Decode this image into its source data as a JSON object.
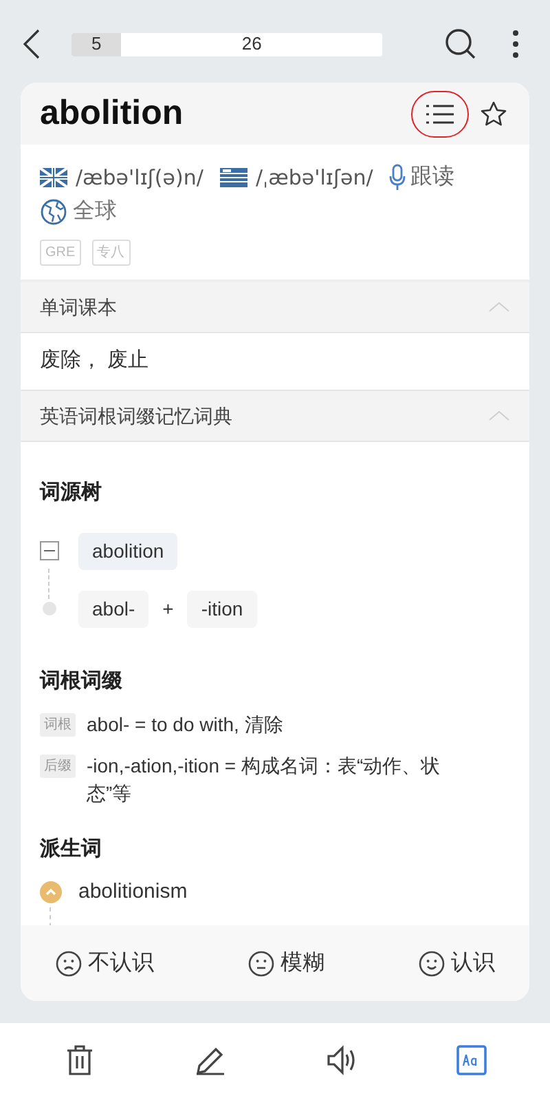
{
  "top_bar": {
    "current": "5",
    "total": "26",
    "level": 0.16
  },
  "word": {
    "text": "abolition",
    "list_highlighted": true,
    "starred": false
  },
  "pronunciations": [
    {
      "kind": "uk",
      "phonetic": "/æbə'lɪʃ(ə)n/"
    },
    {
      "kind": "us",
      "phonetic": "/ˌæbə'lɪʃən/"
    }
  ],
  "follow_read": "跟读",
  "global": "全球",
  "tags": [
    "GRE",
    "专八"
  ],
  "dictionaries": [
    {
      "kind": "meaning",
      "title": "单词课本",
      "expanded": true,
      "meaning": "废除， 废止"
    },
    {
      "kind": "roots",
      "title": "英语词根词缀记忆词典",
      "expanded": true,
      "tree": {
        "title": "词源树",
        "root": "abolition",
        "expanded": true,
        "parts": [
          "abol-",
          "-ition"
        ],
        "joiner": "+"
      },
      "affixes": {
        "title": "词根词缀",
        "items": [
          {
            "tag": "词根",
            "text": "abol- = to do with, 清除"
          },
          {
            "tag": "后缀",
            "text": "-ion,-ation,-ition = 构成名词：表“动作、状态”等"
          }
        ]
      },
      "derived": {
        "title": "派生词",
        "items": [
          {
            "word": "abolitionism",
            "expanded": true
          }
        ]
      }
    }
  ],
  "feedback": [
    {
      "kind": "sad",
      "label": "不认识"
    },
    {
      "kind": "neutral",
      "label": "模糊"
    },
    {
      "kind": "happy",
      "label": "认识"
    }
  ],
  "toolbar": [
    {
      "kind": "trash",
      "selected": false
    },
    {
      "kind": "edit",
      "selected": false
    },
    {
      "kind": "sound",
      "selected": false
    },
    {
      "kind": "dict",
      "selected": true
    }
  ]
}
